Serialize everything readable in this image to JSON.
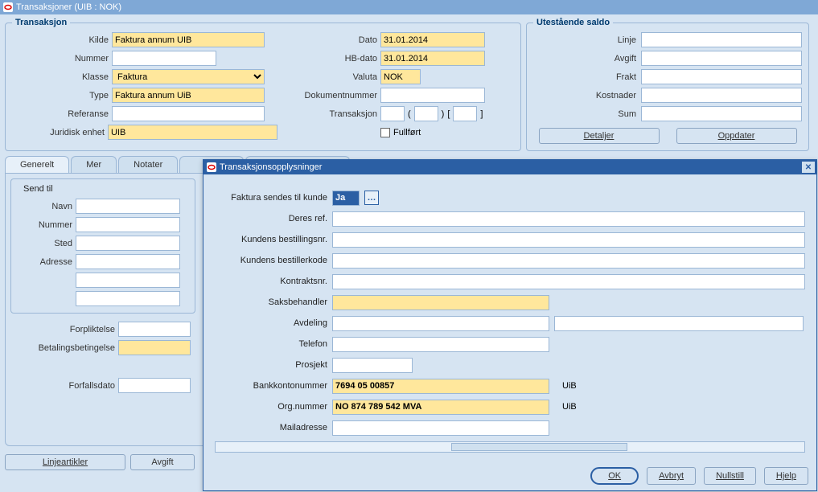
{
  "main": {
    "title": "Transaksjoner (UIB : NOK)"
  },
  "transaksjon": {
    "legend": "Transaksjon",
    "labels": {
      "kilde": "Kilde",
      "nummer": "Nummer",
      "klasse": "Klasse",
      "type": "Type",
      "referanse": "Referanse",
      "juridisk": "Juridisk enhet",
      "dato": "Dato",
      "hbdato": "HB-dato",
      "valuta": "Valuta",
      "dokumentnr": "Dokumentnummer",
      "trans": "Transaksjon",
      "fullfort": "Fullført"
    },
    "values": {
      "kilde": "Faktura annum UIB",
      "nummer": "",
      "klasse": "Faktura",
      "type": "Faktura annum UiB",
      "referanse": "",
      "juridisk": "UIB",
      "dato": "31.01.2014",
      "hbdato": "31.01.2014",
      "valuta": "NOK",
      "dokumentnr": "",
      "trans_a": "",
      "trans_b": "",
      "trans_c": ""
    }
  },
  "saldo": {
    "legend": "Utestående saldo",
    "labels": {
      "linje": "Linje",
      "avgift": "Avgift",
      "frakt": "Frakt",
      "kost": "Kostnader",
      "sum": "Sum"
    },
    "buttons": {
      "detaljer": "Detaljer",
      "oppdater": "Oppdater"
    }
  },
  "tabs": {
    "generelt": "Generelt",
    "mer": "Mer",
    "notater": "Notater"
  },
  "sendtil": {
    "legend": "Send til",
    "labels": {
      "navn": "Navn",
      "nummer": "Nummer",
      "sted": "Sted",
      "adresse": "Adresse",
      "forplikt": "Forpliktelse",
      "betaling": "Betalingsbetingelse",
      "forfall": "Forfallsdato"
    }
  },
  "bottom": {
    "linjeartikler": "Linjeartikler",
    "avgift": "Avgift"
  },
  "dialog": {
    "title": "Transaksjonsopplysninger",
    "labels": {
      "sendes": "Faktura sendes til kunde",
      "deres": "Deres ref.",
      "bestnr": "Kundens bestillingsnr.",
      "bestkode": "Kundens bestillerkode",
      "kontrakt": "Kontraktsnr.",
      "saksbeh": "Saksbehandler",
      "avdeling": "Avdeling",
      "telefon": "Telefon",
      "prosjekt": "Prosjekt",
      "bank": "Bankkontonummer",
      "orgnr": "Org.nummer",
      "mail": "Mailadresse"
    },
    "values": {
      "sendes": "Ja",
      "bank": "7694 05 00857",
      "bank_suffix": "UiB",
      "orgnr": "NO 874 789 542 MVA",
      "orgnr_suffix": "UiB",
      "avdeling": ""
    },
    "buttons": {
      "ok": "OK",
      "avbryt": "Avbryt",
      "nullstill": "Nullstill",
      "hjelp": "Hjelp"
    }
  }
}
